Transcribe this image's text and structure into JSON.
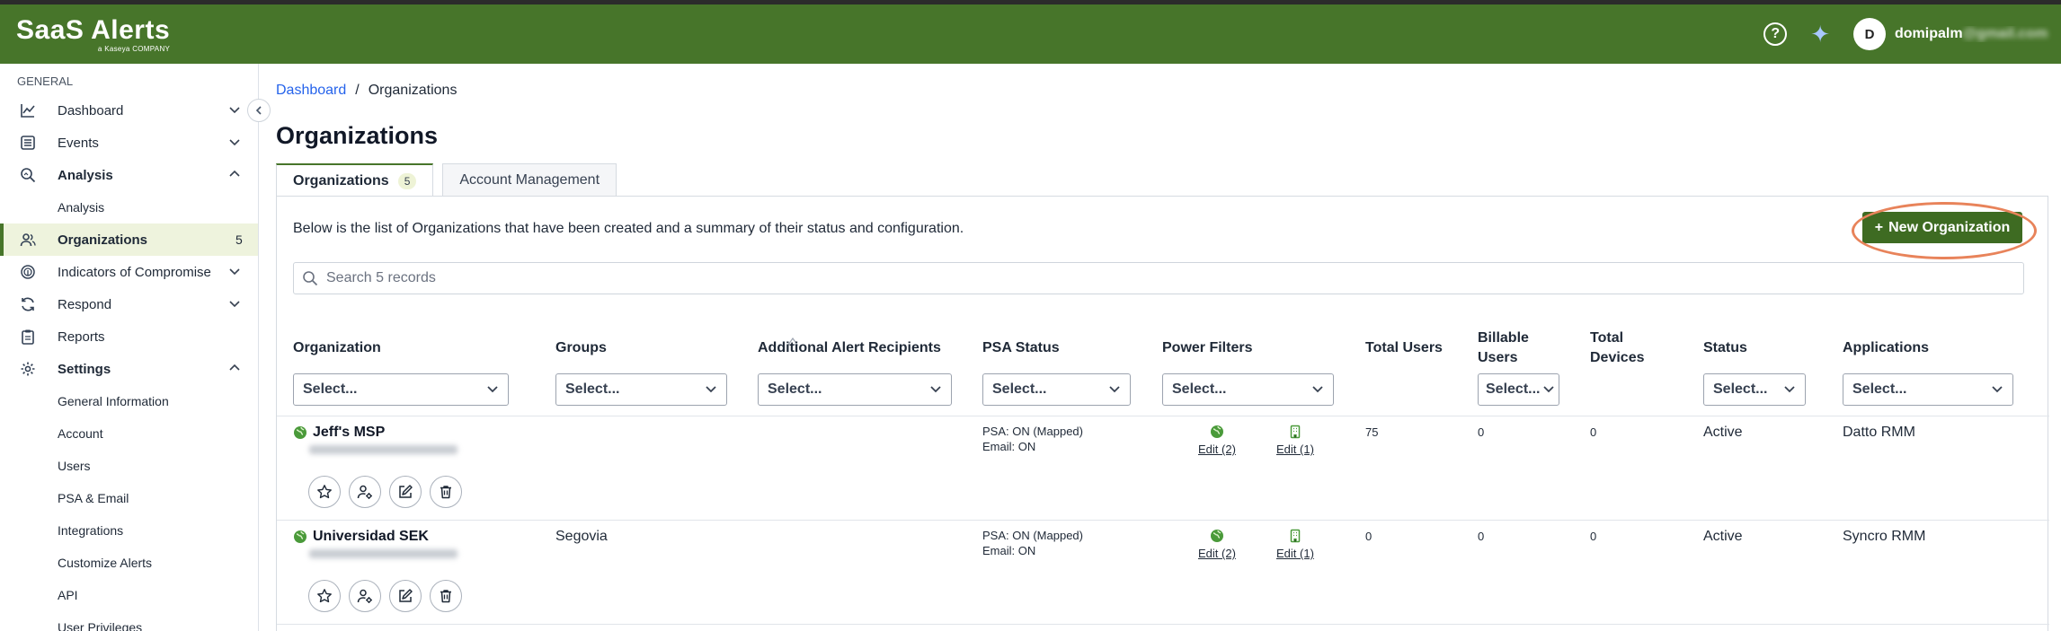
{
  "app": {
    "logo_text": "SaaS Alerts",
    "logo_sub": "a Kaseya COMPANY"
  },
  "topbar": {
    "help_icon": "help-circle-icon",
    "ai_icon": "sparkle-icon",
    "avatar_initial": "D",
    "user_name": "domipalm",
    "user_name_hidden": "@gmail.com"
  },
  "sidebar": {
    "section_label": "GENERAL",
    "items": [
      {
        "label": "Dashboard",
        "icon": "chart-line-icon"
      },
      {
        "label": "Events",
        "icon": "list-icon"
      },
      {
        "label": "Analysis",
        "icon": "search-chart-icon"
      },
      {
        "label": "Analysis"
      },
      {
        "label": "Organizations",
        "icon": "users-icon",
        "count": "5"
      },
      {
        "label": "Indicators of Compromise",
        "icon": "fingerprint-icon"
      },
      {
        "label": "Respond",
        "icon": "refresh-icon"
      },
      {
        "label": "Reports",
        "icon": "clipboard-icon"
      },
      {
        "label": "Settings",
        "icon": "gear-icon"
      }
    ],
    "settings_items": [
      "General Information",
      "Account",
      "Users",
      "PSA & Email",
      "Integrations",
      "Customize Alerts",
      "API",
      "User Privileges"
    ]
  },
  "breadcrumb": {
    "home": "Dashboard",
    "separator": "/",
    "current": "Organizations"
  },
  "page": {
    "title": "Organizations"
  },
  "tabs": [
    {
      "label": "Organizations",
      "badge": "5"
    },
    {
      "label": "Account Management"
    }
  ],
  "panel": {
    "description": "Below is the list of Organizations that have been created and a summary of their status and configuration.",
    "new_button": "New Organization",
    "new_button_icon": "plus-icon",
    "search_placeholder": "Search 5 records"
  },
  "table": {
    "columns": [
      "Organization",
      "Groups",
      "Additional Alert Recipients",
      "PSA Status",
      "Power Filters",
      "Total Users",
      "Billable Users",
      "Total Devices",
      "Status",
      "Applications"
    ],
    "filter_placeholder": "Select...",
    "rows": [
      {
        "name": "Jeff's MSP",
        "groups": "",
        "psa_line1": "PSA: ON (Mapped)",
        "psa_line2": "Email: ON",
        "pf_edit1": "Edit (2)",
        "pf_edit2": "Edit (1)",
        "total_users": "75",
        "billable_users": "0",
        "total_devices": "0",
        "status": "Active",
        "applications": "Datto RMM"
      },
      {
        "name": "Universidad SEK",
        "groups": "Segovia",
        "psa_line1": "PSA: ON (Mapped)",
        "psa_line2": "Email: ON",
        "pf_edit1": "Edit (2)",
        "pf_edit2": "Edit (1)",
        "total_users": "0",
        "billable_users": "0",
        "total_devices": "0",
        "status": "Active",
        "applications": "Syncro RMM"
      }
    ]
  },
  "colors": {
    "brand_green": "#47752a",
    "button_green": "#3e6b22",
    "annotation": "#e8835a",
    "link_blue": "#2563eb"
  }
}
